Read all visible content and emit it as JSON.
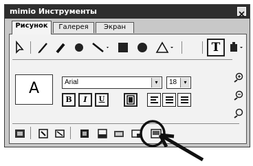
{
  "window": {
    "title": "mimio Инструменты",
    "close_label": "⊠"
  },
  "tabs": [
    {
      "label": "Рисунок",
      "active": true
    },
    {
      "label": "Галерея",
      "active": false
    },
    {
      "label": "Экран",
      "active": false
    }
  ],
  "drawing_tools": {
    "icons": [
      "select-arrow-icon",
      "pen-icon",
      "highlighter-icon",
      "eraser-icon",
      "line-icon",
      "rectangle-icon",
      "ellipse-icon",
      "triangle-icon",
      "text-icon",
      "stamp-icon"
    ],
    "text_tool_glyph": "T"
  },
  "text_settings": {
    "preview_letter": "A",
    "font_value": "Arial",
    "size_value": "18",
    "dropdown_glyph": "▾",
    "bold_label": "B",
    "italic_label": "I",
    "underline_label": "U"
  },
  "bottom_tools": {
    "icons": [
      "capture-icon",
      "fill-icon",
      "outline-icon",
      "screen-icon",
      "window-icon",
      "region-icon",
      "display-icon",
      "sticky-icon"
    ]
  },
  "zoom_icons": [
    "zoom-in-icon",
    "zoom-out-icon",
    "zoom-reset-icon"
  ],
  "colors": {
    "titlebar": "#2e2e2e",
    "frame": "#c8c8c8",
    "panel": "#f2f2f2"
  }
}
